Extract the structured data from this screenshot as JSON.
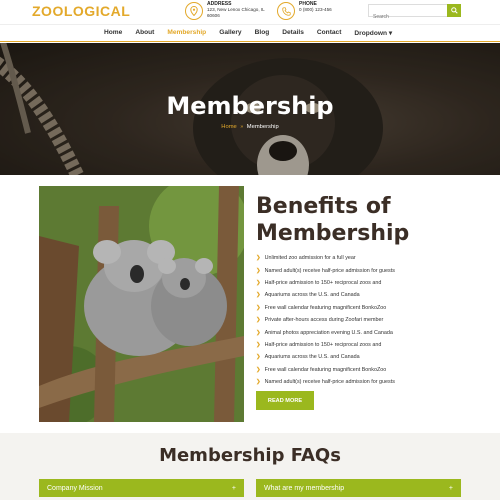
{
  "header": {
    "logo": "ZOOLOGICAL",
    "address_label": "ADDRESS",
    "address_line1": "123, New Lenox Chicago, IL",
    "address_line2": "60606",
    "phone_label": "PHONE",
    "phone_value": "0 (800) 123-456",
    "search_placeholder": "Search"
  },
  "nav": {
    "items": [
      "Home",
      "About",
      "Membership",
      "Gallery",
      "Blog",
      "Details",
      "Contact",
      "Dropdown ▾"
    ],
    "active_index": 2
  },
  "hero": {
    "title": "Membership",
    "breadcrumb_home": "Home",
    "breadcrumb_sep": "»",
    "breadcrumb_current": "Membership"
  },
  "benefits": {
    "title": "Benefits of Membership",
    "items": [
      "Unlimited zoo admission for a full year",
      "Named adult(s) receive half-price admission for guests",
      "Half-price admission to 150+ reciprocal zoos and",
      "Aquariums across the U.S. and Canada",
      "Free wall calendar featuring magnificent BonkoZoo",
      "Private after-hours access during Zoofari member",
      "Animal photos appreciation evening U.S. and Canada",
      "Half-price admission to 150+ reciprocal zoos and",
      "Aquariums across the U.S. and Canada",
      "Free wall calendar featuring magnificent BonkoZoo",
      "Named adult(s) receive half-price admission for guests"
    ],
    "button": "READ MORE"
  },
  "faq": {
    "title": "Membership FAQs",
    "items": [
      {
        "label": "Company Mission",
        "icon": "+"
      },
      {
        "label": "What are my membership",
        "icon": "+"
      }
    ]
  },
  "colors": {
    "accent": "#e3a92b",
    "green": "#9bb81e",
    "heading": "#3b2e26"
  }
}
